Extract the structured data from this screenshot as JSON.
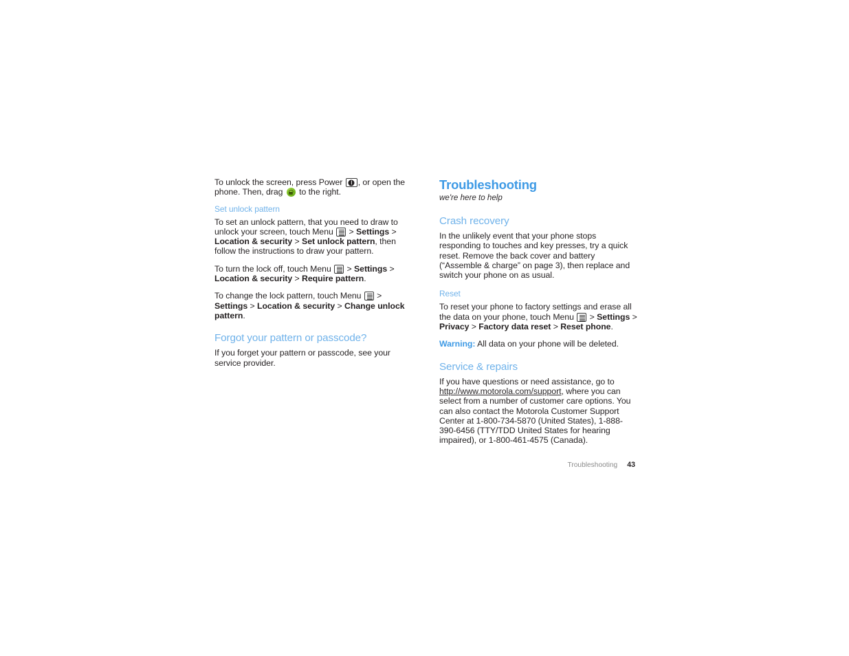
{
  "colors": {
    "chapter_heading": "#3e9ae5",
    "section_heading": "#6fb2ea",
    "body_text": "#231f20",
    "footer_text": "#8b8b8b",
    "lock_icon_green": "#7cc023"
  },
  "left_column": {
    "intro": {
      "part1": "To unlock the screen, press Power ",
      "part2": ", or open the phone. Then, drag ",
      "part3": " to the right."
    },
    "set_unlock_pattern": {
      "heading": "Set unlock pattern",
      "p1": {
        "part1": "To set an unlock pattern, that you need to draw to unlock your screen, touch Menu ",
        "part2": " > ",
        "bold1": "Settings",
        "part3": " > ",
        "bold2": "Location & security",
        "part4": " > ",
        "bold3": "Set unlock pattern",
        "part5": ", then follow the instructions to draw your pattern."
      },
      "p2": {
        "part1": "To turn the lock off, touch Menu ",
        "part2": " > ",
        "bold1": "Settings",
        "part3": " > ",
        "bold2": "Location & security",
        "part4": " > ",
        "bold3": "Require pattern",
        "part5": "."
      },
      "p3": {
        "part1": "To change the lock pattern, touch Menu ",
        "part2": " > ",
        "bold1": "Settings",
        "part3": " > ",
        "bold2": "Location & security",
        "part4": " > ",
        "bold3": "Change unlock pattern",
        "part5": "."
      }
    },
    "forgot": {
      "heading": "Forgot your pattern or passcode?",
      "body": "If you forget your pattern or passcode, see your service provider."
    }
  },
  "right_column": {
    "chapter_title": "Troubleshooting",
    "chapter_subtitle": "we're here to help",
    "crash_recovery": {
      "heading": "Crash recovery",
      "body": "In the unlikely event that your phone stops responding to touches and key presses, try a quick reset. Remove the back cover and battery (“Assemble & charge” on page 3), then replace and switch your phone on as usual."
    },
    "reset": {
      "heading": "Reset",
      "p1": {
        "part1": "To reset your phone to factory settings and erase all the data on your phone, touch Menu ",
        "part2": " > ",
        "bold1": "Settings",
        "part3": " > ",
        "bold2": "Privacy",
        "part4": " > ",
        "bold3": "Factory data reset",
        "part5": " > ",
        "bold4": "Reset phone",
        "part6": "."
      },
      "warning_label": "Warning:",
      "warning_text": " All data on your phone will be deleted."
    },
    "service_repairs": {
      "heading": "Service & repairs",
      "part1": "If you have questions or need assistance, go to ",
      "url": "http://www.motorola.com/support",
      "part2": ", where you can select from a number of customer care options. You can also contact the Motorola Customer Support Center at 1-800-734-5870 (United States), 1-888-390-6456 (TTY/TDD United States for hearing impaired), or 1-800-461-4575 (Canada)."
    }
  },
  "footer": {
    "chapter": "Troubleshooting",
    "page_number": "43"
  },
  "icons": {
    "power_key": "power-key-icon",
    "menu_key": "menu-key-icon",
    "lock_drag": "lock-drag-icon"
  }
}
